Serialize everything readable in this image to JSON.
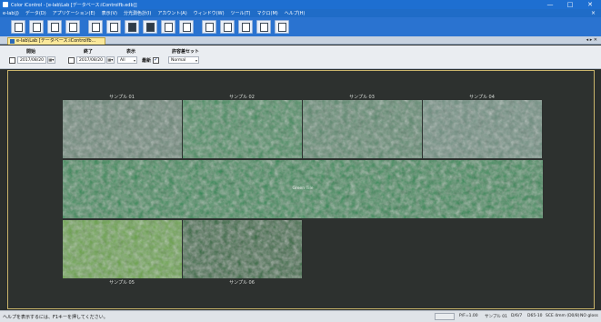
{
  "window": {
    "title": "Color iControl - [e-lab\\Lab [データベース:iControlfb.edb]]",
    "controls": [
      "—",
      "□",
      "✕"
    ]
  },
  "menu": {
    "items": [
      "e-lab(J)",
      "データ(D)",
      "アプリケーション(E)",
      "表示(V)",
      "分光測色計(I)",
      "アカウント(A)",
      "ウィンドウ(W)",
      "ツール(T)",
      "マクロ(M)",
      "ヘルプ(H)"
    ],
    "close": "×"
  },
  "toolbar": {
    "icons": [
      "new-doc-icon",
      "open-doc-icon",
      "copy-doc-icon",
      "print-preview-icon",
      "print-icon",
      "export-icon",
      "compare-icon",
      "measure-icon",
      "scale-icon",
      "chart-icon",
      "report-icon",
      "table-icon",
      "settings-icon",
      "graph-icon",
      "window-icon"
    ]
  },
  "tabs": {
    "active_label": "e-lab\\Lab [データベース:iControlfb...",
    "controls": "◂ ▸ ✕"
  },
  "filter": {
    "start_label": "開始",
    "start_date": "2017/08/20",
    "end_label": "終了",
    "end_date": "2017/08/20",
    "display_label": "表示",
    "display_value": "All",
    "latest_label": "最新",
    "tolerance_label": "許容差セット",
    "tolerance_value": "Normal"
  },
  "samples": {
    "top": [
      {
        "label": "サンプル 01",
        "color": "#6a8878"
      },
      {
        "label": "サンプル 02",
        "color": "#3f8d5e"
      },
      {
        "label": "サンプル 03",
        "color": "#5a8a6e"
      },
      {
        "label": "サンプル 04",
        "color": "#6d8f80"
      }
    ],
    "wide": {
      "label": "Green Tile",
      "color": "#2f8a56"
    },
    "bottom": [
      {
        "label": "サンプル 05",
        "color": "#69a445"
      },
      {
        "label": "サンプル 06",
        "color": "#2e6a3e"
      }
    ]
  },
  "status": {
    "help": "ヘルプを表示するには、F1キーを押してください。",
    "pf": "P/F=1.00",
    "sample": "サンプル 01",
    "illum": "D/6/7",
    "d65": "D65-10",
    "sce": "SCE 4mm (D0/8)",
    "gloss": "NO gloss"
  },
  "colors": {
    "title_bar": "#1e6fd1",
    "workspace": "#2d312f",
    "active_tab": "#fbe89a"
  }
}
